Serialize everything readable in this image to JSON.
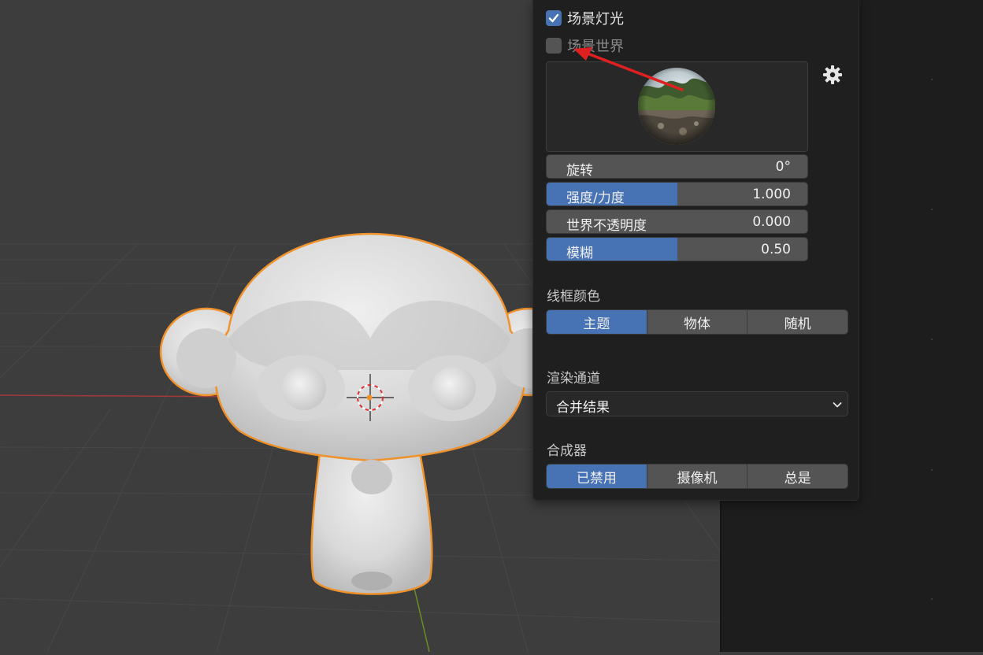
{
  "viewport": {
    "object": "monkey-mesh",
    "cursor": "3d-cursor-icon"
  },
  "overlay_popover": {
    "scene_lights": {
      "label": "场景灯光",
      "checked": true
    },
    "scene_world": {
      "label": "场景世界",
      "checked": false
    },
    "hdri_preview": {
      "icon": "hdri-sphere-icon"
    },
    "settings_icon": "gear-icon",
    "sliders": [
      {
        "label": "旋转",
        "value": "0°",
        "fraction": 0
      },
      {
        "label": "强度/力度",
        "value": "1.000",
        "fraction": 0.5
      },
      {
        "label": "世界不透明度",
        "value": "0.000",
        "fraction": 0
      },
      {
        "label": "模糊",
        "value": "0.50",
        "fraction": 0.5
      }
    ],
    "wireframe_color": {
      "title": "线框颜色",
      "options": [
        "主题",
        "物体",
        "随机"
      ],
      "selected": "主题"
    },
    "render_pass": {
      "title": "渲染通道",
      "value": "合并结果"
    },
    "compositor": {
      "title": "合成器",
      "options": [
        "已禁用",
        "摄像机",
        "总是"
      ],
      "selected": "已禁用"
    }
  },
  "colors": {
    "accent": "#4772b3",
    "panel_bg": "#1f1f1f",
    "viewport_bg": "#3d3d3d",
    "selection_outline": "#f0922c",
    "annotation_arrow": "#e02020"
  }
}
